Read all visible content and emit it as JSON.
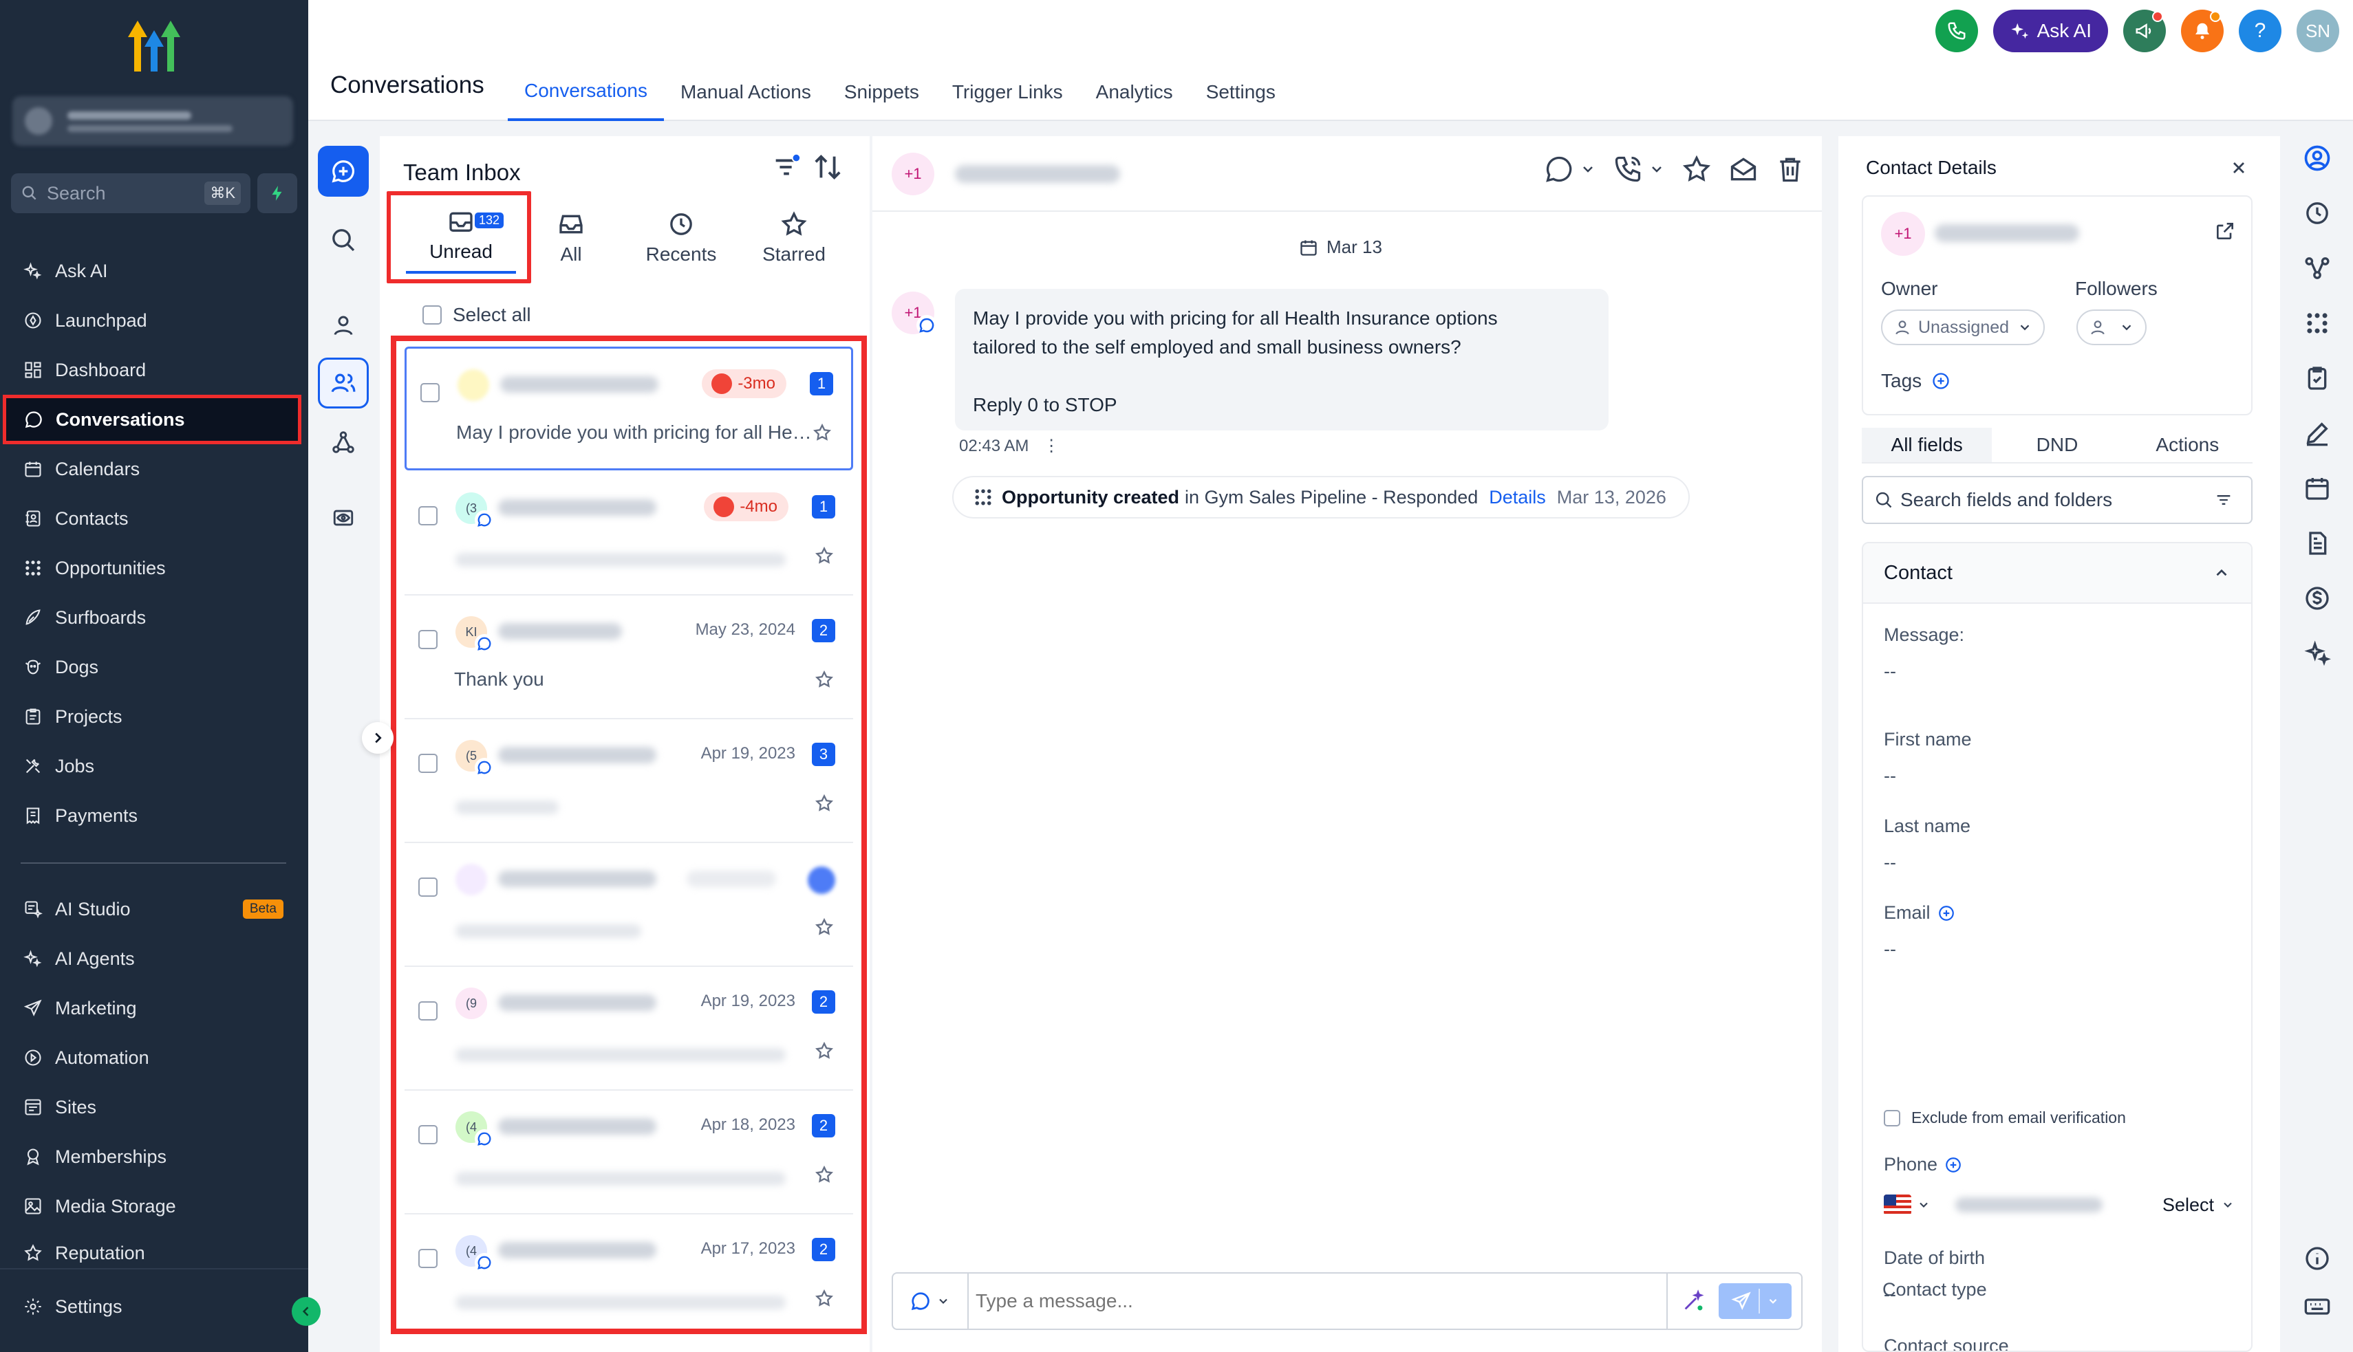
{
  "sidebar": {
    "search_placeholder": "Search",
    "search_shortcut": "⌘K",
    "items": [
      {
        "label": "Ask AI"
      },
      {
        "label": "Launchpad"
      },
      {
        "label": "Dashboard"
      },
      {
        "label": "Conversations"
      },
      {
        "label": "Calendars"
      },
      {
        "label": "Contacts"
      },
      {
        "label": "Opportunities"
      },
      {
        "label": "Surfboards"
      },
      {
        "label": "Dogs"
      },
      {
        "label": "Projects"
      },
      {
        "label": "Jobs"
      },
      {
        "label": "Payments"
      }
    ],
    "items2": [
      {
        "label": "AI Studio",
        "badge": "Beta"
      },
      {
        "label": "AI Agents"
      },
      {
        "label": "Marketing"
      },
      {
        "label": "Automation"
      },
      {
        "label": "Sites"
      },
      {
        "label": "Memberships"
      },
      {
        "label": "Media Storage"
      },
      {
        "label": "Reputation"
      }
    ],
    "settings_label": "Settings"
  },
  "header": {
    "title": "Conversations",
    "tabs": [
      {
        "label": "Conversations"
      },
      {
        "label": "Manual Actions"
      },
      {
        "label": "Snippets"
      },
      {
        "label": "Trigger Links"
      },
      {
        "label": "Analytics"
      },
      {
        "label": "Settings"
      }
    ],
    "ask_ai_label": "Ask AI",
    "help_label": "?",
    "user_initials": "SN"
  },
  "inbox": {
    "title": "Team Inbox",
    "tabs": [
      {
        "label": "Unread",
        "badge": "132"
      },
      {
        "label": "All"
      },
      {
        "label": "Recents"
      },
      {
        "label": "Starred"
      }
    ],
    "select_all_label": "Select all",
    "conversations": [
      {
        "avatar": "",
        "dnd": "-3mo",
        "date": "",
        "count": "1",
        "preview": "May I provide you with pricing for all Health Insurance options tailored to the self employed and small business owners?"
      },
      {
        "avatar": "(3",
        "dnd": "-4mo",
        "date": "",
        "count": "1",
        "preview": ""
      },
      {
        "avatar": "KI",
        "dnd": "",
        "date": "May 23, 2024",
        "count": "2",
        "preview": "Thank you"
      },
      {
        "avatar": "(5",
        "dnd": "",
        "date": "Apr 19, 2023",
        "count": "3",
        "preview": ""
      },
      {
        "avatar": "",
        "dnd": "",
        "date": "",
        "count": "",
        "preview": ""
      },
      {
        "avatar": "(9",
        "dnd": "",
        "date": "Apr 19, 2023",
        "count": "2",
        "preview": ""
      },
      {
        "avatar": "(4",
        "dnd": "",
        "date": "Apr 18, 2023",
        "count": "2",
        "preview": ""
      },
      {
        "avatar": "(4",
        "dnd": "",
        "date": "Apr 17, 2023",
        "count": "2",
        "preview": ""
      }
    ]
  },
  "chat": {
    "contact_prefix": "+1",
    "date_divider": "Mar 13",
    "message": {
      "line1": "May I provide you with pricing for all Health Insurance options",
      "line2": "tailored to the self employed and small business owners?",
      "line3": "Reply 0 to STOP",
      "time": "02:43 AM"
    },
    "activity": {
      "bold": "Opportunity created",
      "text": "in Gym Sales Pipeline - Responded",
      "link": "Details",
      "date": "Mar 13, 2026"
    },
    "composer_placeholder": "Type a message..."
  },
  "details": {
    "title": "Contact Details",
    "owner_label": "Owner",
    "owner_value": "Unassigned",
    "followers_label": "Followers",
    "tags_label": "Tags",
    "tabs": [
      {
        "label": "All fields"
      },
      {
        "label": "DND"
      },
      {
        "label": "Actions"
      }
    ],
    "search_placeholder": "Search fields and folders",
    "section_title": "Contact",
    "fields": [
      {
        "label": "Message:",
        "value": "--"
      },
      {
        "label": "First name",
        "value": "--"
      },
      {
        "label": "Last name",
        "value": "--"
      },
      {
        "label": "Email",
        "value": "--"
      },
      {
        "label": "Phone",
        "value": ""
      },
      {
        "label": "Date of birth",
        "value": "--"
      },
      {
        "label": "Contact source",
        "value": "--"
      },
      {
        "label": "Contact type",
        "value": ""
      }
    ],
    "exclude_label": "Exclude from email verification",
    "phone_select_label": "Select"
  },
  "colors": {
    "accent": "#155eef",
    "sidebar_bg": "#1e2b3c",
    "highlight": "#ef2c2c",
    "ask_ai": "#4527a0"
  }
}
